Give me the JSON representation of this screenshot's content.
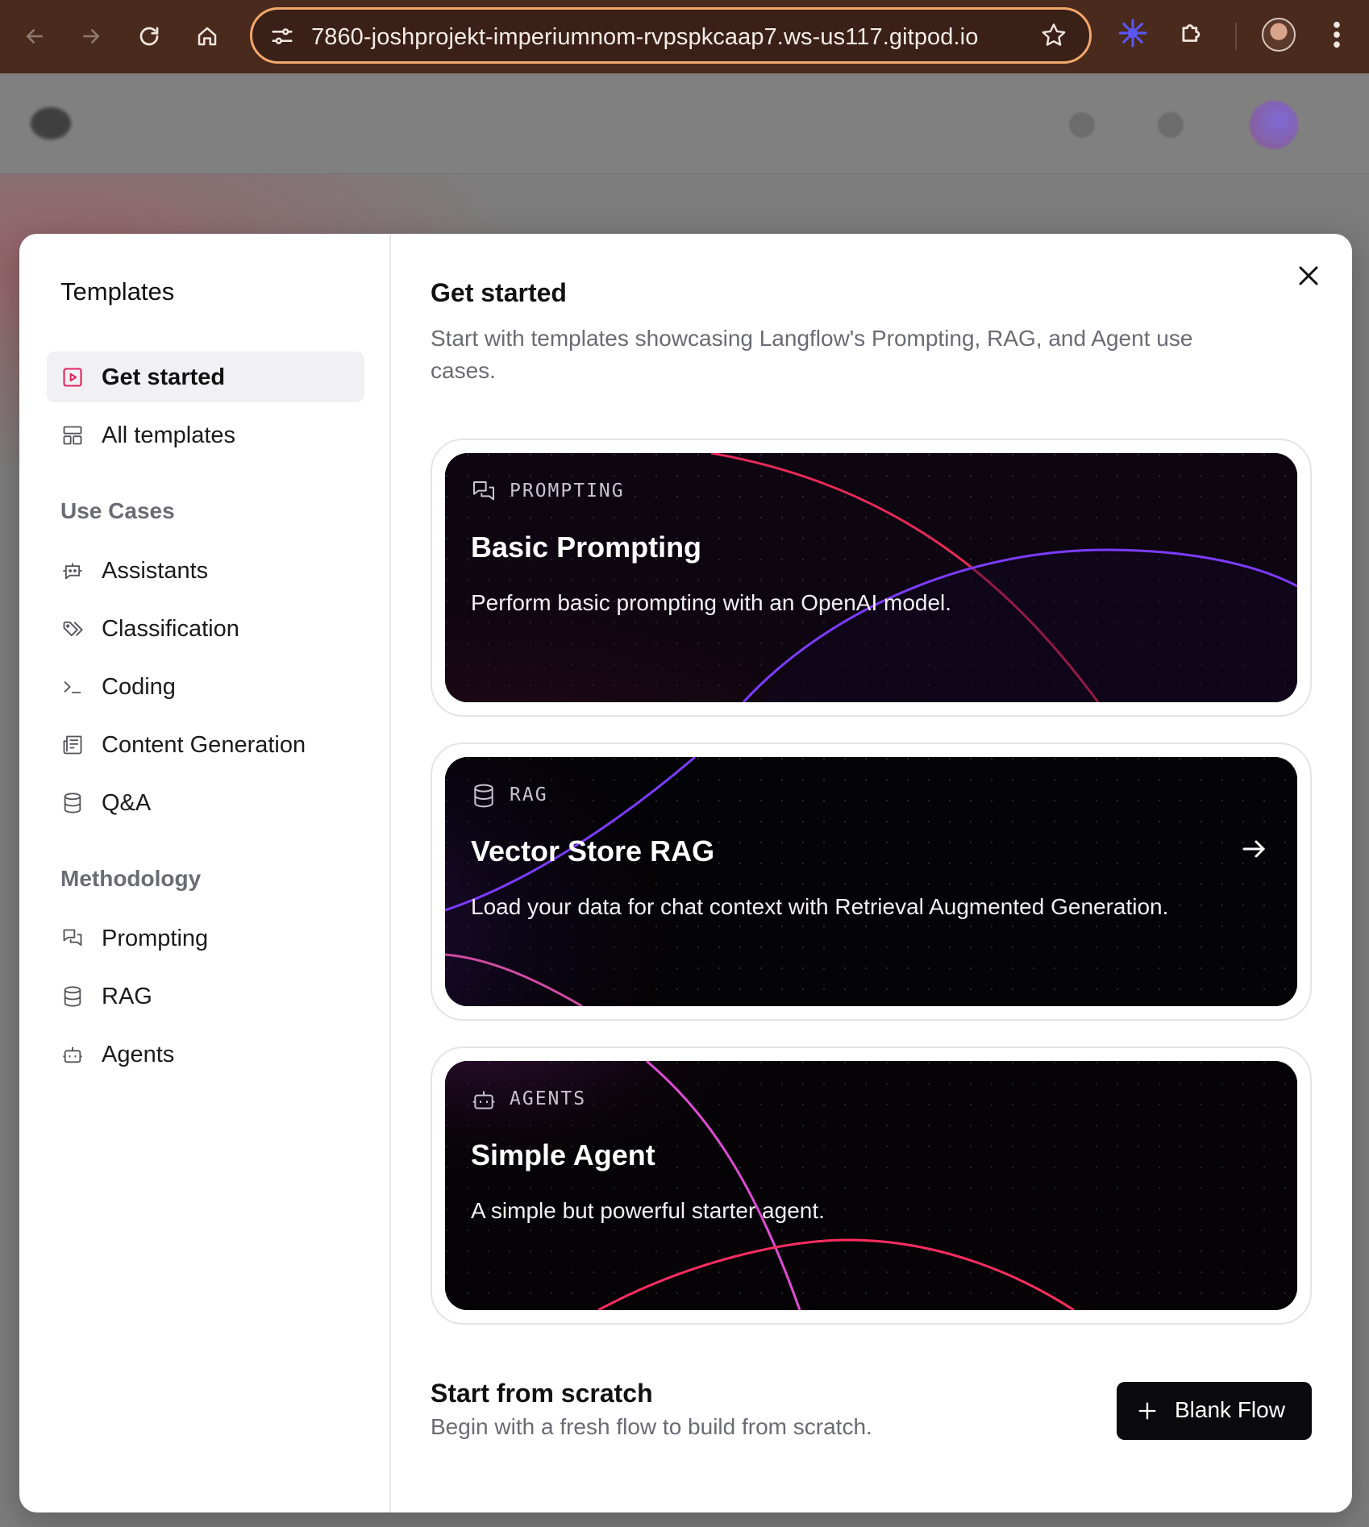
{
  "browser": {
    "url": "7860-joshprojekt-imperiumnom-rvpspkcaap7.ws-us117.gitpod.io",
    "icons": [
      "back-icon",
      "forward-icon",
      "reload-icon",
      "home-icon",
      "site-info-icon",
      "star-icon",
      "extension-sparkle-icon",
      "extensions-puzzle-icon",
      "profile-avatar",
      "more-menu-icon"
    ]
  },
  "sidebar": {
    "title": "Templates",
    "items": [
      {
        "label": "Get started",
        "icon": "play-square-icon",
        "active": true
      },
      {
        "label": "All templates",
        "icon": "layout-grid-icon",
        "active": false
      }
    ],
    "use_cases_heading": "Use Cases",
    "use_cases": [
      {
        "label": "Assistants",
        "icon": "bot-message-icon"
      },
      {
        "label": "Classification",
        "icon": "tags-icon"
      },
      {
        "label": "Coding",
        "icon": "terminal-icon"
      },
      {
        "label": "Content Generation",
        "icon": "newspaper-icon"
      },
      {
        "label": "Q&A",
        "icon": "database-icon"
      }
    ],
    "methodology_heading": "Methodology",
    "methodology": [
      {
        "label": "Prompting",
        "icon": "messages-icon"
      },
      {
        "label": "RAG",
        "icon": "database-icon"
      },
      {
        "label": "Agents",
        "icon": "bot-icon"
      }
    ]
  },
  "main": {
    "title": "Get started",
    "subtitle": "Start with templates showcasing Langflow's Prompting, RAG, and Agent use cases.",
    "cards": [
      {
        "category": "PROMPTING",
        "title": "Basic Prompting",
        "description": "Perform basic prompting with an OpenAI model.",
        "icon": "messages-icon"
      },
      {
        "category": "RAG",
        "title": "Vector Store RAG",
        "description": "Load your data for chat context with Retrieval Augmented Generation.",
        "icon": "database-icon"
      },
      {
        "category": "AGENTS",
        "title": "Simple Agent",
        "description": "A simple but powerful starter agent.",
        "icon": "bot-icon"
      }
    ],
    "scratch": {
      "title": "Start from scratch",
      "subtitle": "Begin with a fresh flow to build from scratch.",
      "button_label": "Blank Flow"
    }
  },
  "colors": {
    "chrome": "#4a2a1c",
    "url_outline": "#f2a86c",
    "accent_pink": "#e8345a",
    "accent_purple": "#6a2cf0",
    "button_dark": "#0b0b0d"
  }
}
